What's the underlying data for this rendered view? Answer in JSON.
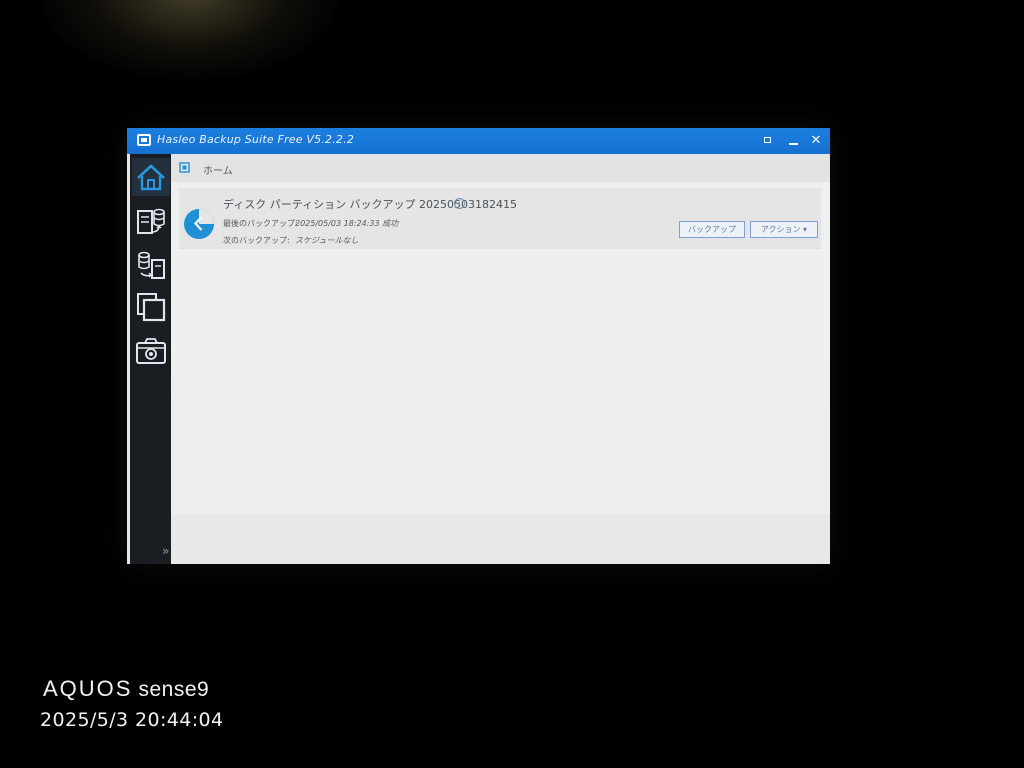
{
  "window": {
    "title": "Hasleo Backup Suite Free V5.2.2.2",
    "controls": {
      "restore": "restore-icon",
      "minimize": "minimize-icon",
      "close": "✕"
    }
  },
  "sidebar": {
    "items": [
      {
        "icon": "home-icon",
        "selected": true
      },
      {
        "icon": "backup-icon"
      },
      {
        "icon": "restore-icon"
      },
      {
        "icon": "clone-icon"
      },
      {
        "icon": "camera-icon"
      }
    ],
    "expand_label": "»"
  },
  "breadcrumb": {
    "label": "ホーム"
  },
  "backup_task": {
    "title": "ディスク パーティション バックアップ 20250503182415",
    "info_glyph": "i",
    "last_backup_label": "最後のバックアップ:",
    "last_backup_value": "2025/05/03 18:24:33 成功",
    "next_backup_label": "次のバックアップ:",
    "next_backup_value": "スケジュールなし",
    "backup_button": "バックアップ",
    "action_button": "アクション ▾"
  },
  "photo_watermark": {
    "brand": "AQUOS",
    "model": "sense9",
    "datetime": "2025/5/3 20:44:04"
  },
  "colors": {
    "titlebar": "#1670d0",
    "accent": "#1f8fd6",
    "sidebar": "#1a1d22"
  }
}
